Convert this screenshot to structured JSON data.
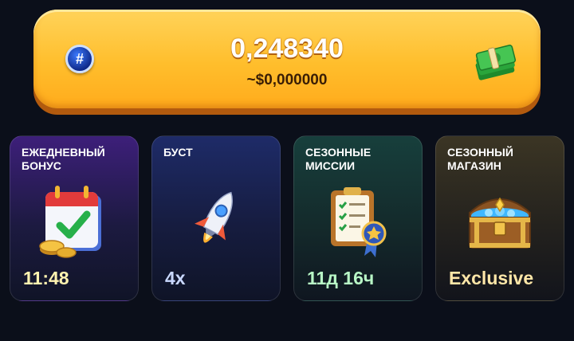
{
  "balance": {
    "amount": "0,248340",
    "usd_equivalent": "~$0,000000",
    "left_icon": "hash-coin-icon",
    "right_icon": "cash-stack-icon"
  },
  "cards": [
    {
      "title": "ЕЖЕДНЕВНЫЙ БОНУС",
      "value": "11:48",
      "icon": "calendar-check-icon",
      "value_color": "#fff3b0"
    },
    {
      "title": "БУСТ",
      "value": "4x",
      "icon": "rocket-icon",
      "value_color": "#c9d8ff"
    },
    {
      "title": "СЕЗОННЫЕ МИССИИ",
      "value": "11д 16ч",
      "icon": "clipboard-medal-icon",
      "value_color": "#b8f7c6"
    },
    {
      "title": "СЕЗОННЫЙ МАГАЗИН",
      "value": "Exclusive",
      "icon": "treasure-chest-icon",
      "value_color": "#ffe7a8"
    }
  ]
}
